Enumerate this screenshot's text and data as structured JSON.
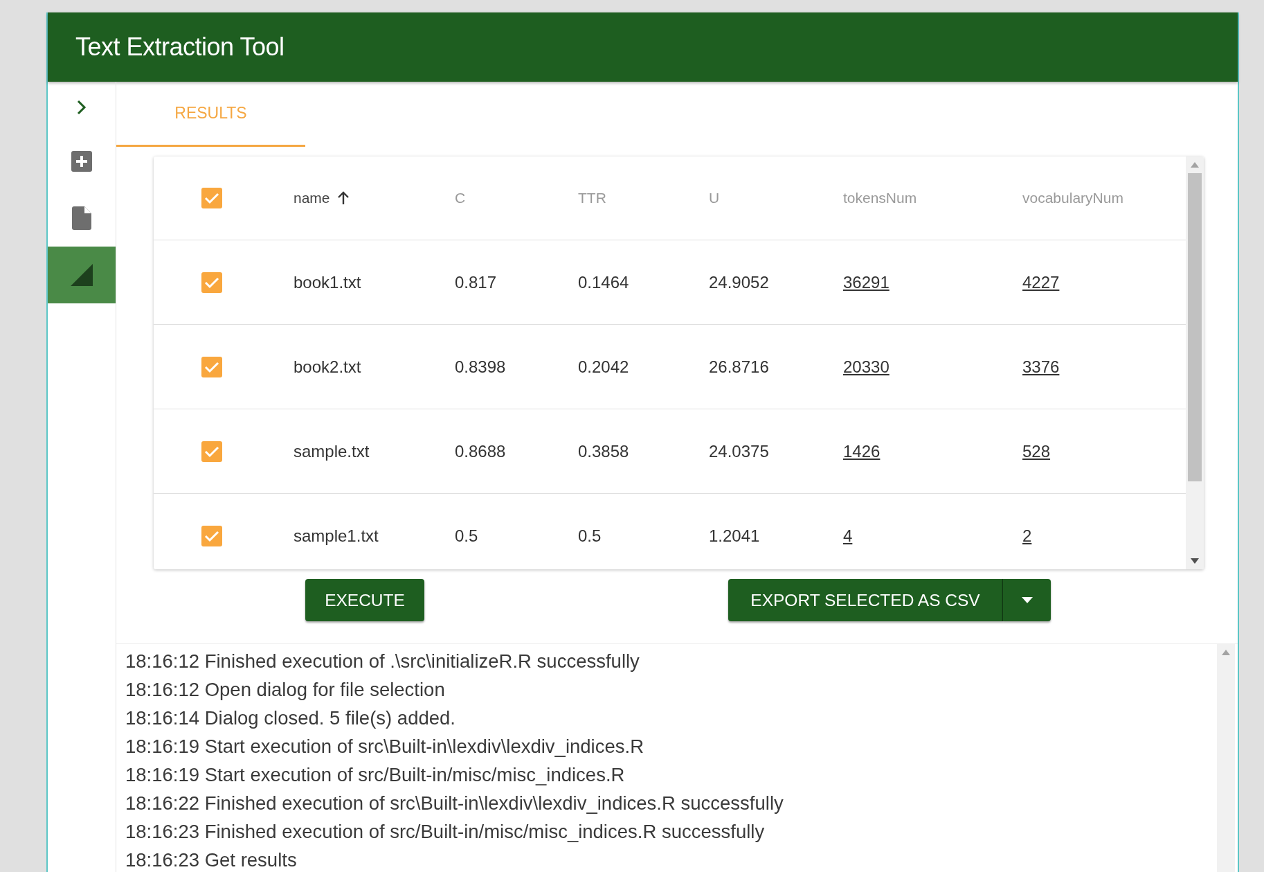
{
  "window": {
    "title": "Text Extraction Tool"
  },
  "sidebar": {
    "items": [
      {
        "kind": "expand",
        "selected": false
      },
      {
        "kind": "add",
        "selected": false
      },
      {
        "kind": "file",
        "selected": false
      },
      {
        "kind": "results",
        "selected": true
      }
    ]
  },
  "tabs": [
    {
      "label": "RESULTS",
      "selected": true
    }
  ],
  "table": {
    "select_all_checked": true,
    "columns": [
      {
        "label": "name",
        "sorted": true,
        "kind": "text"
      },
      {
        "label": "C",
        "sorted": false,
        "kind": "text"
      },
      {
        "label": "TTR",
        "sorted": false,
        "kind": "text"
      },
      {
        "label": "U",
        "sorted": false,
        "kind": "text"
      },
      {
        "label": "tokensNum",
        "sorted": false,
        "kind": "link"
      },
      {
        "label": "vocabularyNum",
        "sorted": false,
        "kind": "link"
      }
    ],
    "rows": [
      {
        "checked": true,
        "cells": [
          "book1.txt",
          "0.817",
          "0.1464",
          "24.9052",
          "36291",
          "4227"
        ]
      },
      {
        "checked": true,
        "cells": [
          "book2.txt",
          "0.8398",
          "0.2042",
          "26.8716",
          "20330",
          "3376"
        ]
      },
      {
        "checked": true,
        "cells": [
          "sample.txt",
          "0.8688",
          "0.3858",
          "24.0375",
          "1426",
          "528"
        ]
      },
      {
        "checked": true,
        "cells": [
          "sample1.txt",
          "0.5",
          "0.5",
          "1.2041",
          "4",
          "2"
        ]
      }
    ]
  },
  "buttons": {
    "execute": "EXECUTE",
    "export": "EXPORT SELECTED AS CSV"
  },
  "log": [
    "18:16:12 Finished execution of .\\src\\initializeR.R successfully",
    "18:16:12 Open dialog for file selection",
    "18:16:14 Dialog closed. 5 file(s) added.",
    "18:16:19 Start execution of src\\Built-in\\lexdiv\\lexdiv_indices.R",
    "18:16:19 Start execution of src/Built-in/misc/misc_indices.R",
    "18:16:22 Finished execution of src\\Built-in\\lexdiv\\lexdiv_indices.R successfully",
    "18:16:23 Finished execution of src/Built-in/misc/misc_indices.R successfully",
    "18:16:23 Get results"
  ]
}
